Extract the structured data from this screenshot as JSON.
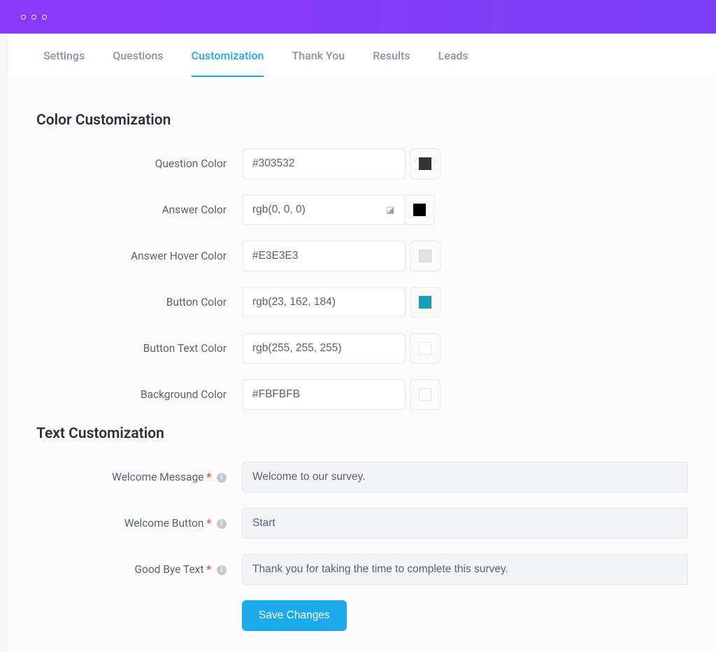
{
  "tabs": {
    "items": [
      {
        "label": "Settings",
        "active": false
      },
      {
        "label": "Questions",
        "active": false
      },
      {
        "label": "Customization",
        "active": true
      },
      {
        "label": "Thank You",
        "active": false
      },
      {
        "label": "Results",
        "active": false
      },
      {
        "label": "Leads",
        "active": false
      }
    ]
  },
  "sections": {
    "color_title": "Color Customization",
    "text_title": "Text Customization"
  },
  "color_fields": {
    "question_color": {
      "label": "Question Color",
      "value": "#303532",
      "swatch": "#303532"
    },
    "answer_color": {
      "label": "Answer Color",
      "value": "rgb(0, 0, 0)",
      "swatch": "#000000",
      "has_badge": true
    },
    "answer_hover_color": {
      "label": "Answer Hover Color",
      "value": "#E3E3E3",
      "swatch": "#e3e3e3"
    },
    "button_color": {
      "label": "Button Color",
      "value": "rgb(23, 162, 184)",
      "swatch": "rgb(23,162,184)"
    },
    "button_text_color": {
      "label": "Button Text Color",
      "value": "rgb(255, 255, 255)",
      "swatch": "#ffffff"
    },
    "background_color": {
      "label": "Background Color",
      "value": "#FBFBFB",
      "swatch": "#fbfbfb"
    }
  },
  "text_fields": {
    "welcome_message": {
      "label": "Welcome Message",
      "value": "Welcome to our survey."
    },
    "welcome_button": {
      "label": "Welcome Button",
      "value": "Start"
    },
    "goodbye_text": {
      "label": "Good Bye Text",
      "value": "Thank you for taking the time to complete this survey."
    }
  },
  "buttons": {
    "save": "Save Changes"
  }
}
